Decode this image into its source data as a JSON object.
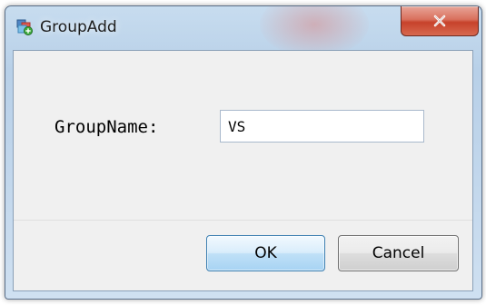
{
  "window": {
    "title": "GroupAdd",
    "app_icon": "group-add-icon",
    "close_icon": "close-icon"
  },
  "form": {
    "group_name_label": "GroupName:",
    "group_name_value": "VS"
  },
  "buttons": {
    "ok_label": "OK",
    "cancel_label": "Cancel"
  },
  "colors": {
    "close_button": "#c7422b",
    "ok_button_border": "#3c7fb1",
    "dialog_background": "#f0f0f0"
  }
}
